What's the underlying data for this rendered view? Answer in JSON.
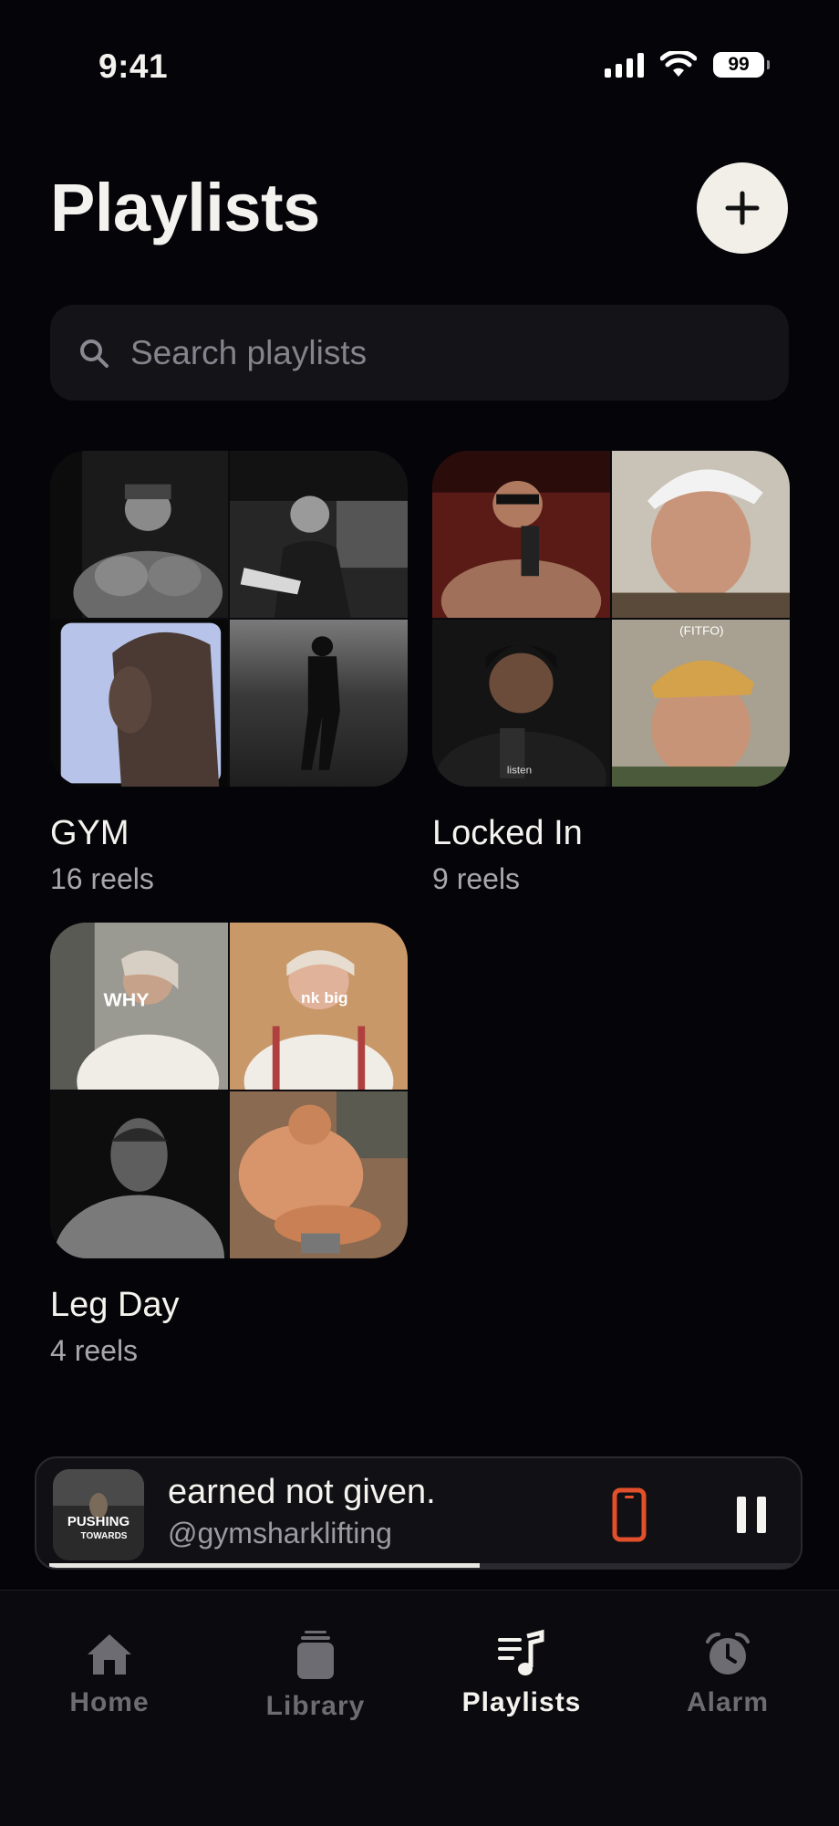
{
  "status_bar": {
    "time": "9:41",
    "battery": "99"
  },
  "header": {
    "title": "Playlists"
  },
  "search": {
    "placeholder": "Search playlists"
  },
  "playlists": [
    {
      "name": "GYM",
      "count": "16 reels"
    },
    {
      "name": "Locked In",
      "count": "9 reels"
    },
    {
      "name": "Leg Day",
      "count": "4 reels"
    }
  ],
  "thumbnail_captions": {
    "locked_in_tile_4": "(FITFO)",
    "locked_in_tile_3": "listen",
    "leg_day_tile_1": "WHY",
    "leg_day_tile_2": "nk big"
  },
  "now_playing": {
    "title": "earned not given.",
    "artist": "@gymsharklifting",
    "art_text_1": "PUSHING",
    "art_text_2": "TOWARDS",
    "progress": 0.58
  },
  "tabs": [
    {
      "label": "Home",
      "active": false
    },
    {
      "label": "Library",
      "active": false
    },
    {
      "label": "Playlists",
      "active": true
    },
    {
      "label": "Alarm",
      "active": false
    }
  ],
  "colors": {
    "accent_device": "#e2502b",
    "background": "#050409"
  }
}
